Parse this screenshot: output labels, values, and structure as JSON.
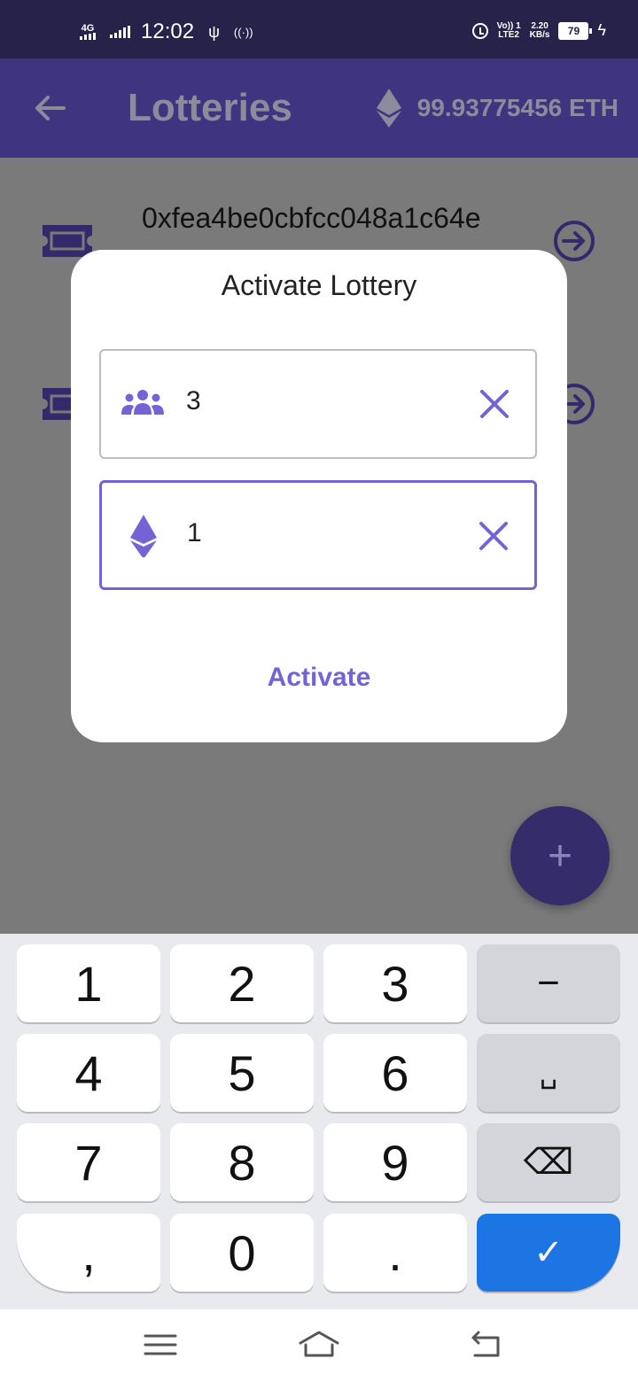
{
  "status_bar": {
    "network": "4G",
    "time": "12:02",
    "volte_top": "Vo)) 1",
    "volte_bottom": "LTE2",
    "speed_value": "2.20",
    "speed_unit": "KB/s",
    "battery": "79"
  },
  "app_bar": {
    "title": "Lotteries",
    "eth_balance": "99.93775456 ETH",
    "back_icon": "arrow-left-icon",
    "eth_icon": "ethereum-icon"
  },
  "lotteries": [
    {
      "address": "0xfea4be0cbfcc048a1c64e"
    },
    {
      "address": ""
    }
  ],
  "dialog": {
    "title": "Activate Lottery",
    "participants_value": "3",
    "participants_icon": "people-group-icon",
    "eth_value": "1",
    "eth_icon": "ethereum-icon",
    "activate_label": "Activate"
  },
  "fab": {
    "label": "+"
  },
  "keyboard": {
    "keys": [
      "1",
      "2",
      "3",
      "−",
      "4",
      "5",
      "6",
      "␣",
      "7",
      "8",
      "9",
      "⌫",
      ",",
      "0",
      ".",
      "✓"
    ]
  },
  "colors": {
    "accent": "#7463d6",
    "app_bar": "#3f3480",
    "status_bar": "#27224a",
    "keyboard_ok": "#1d74e3"
  }
}
